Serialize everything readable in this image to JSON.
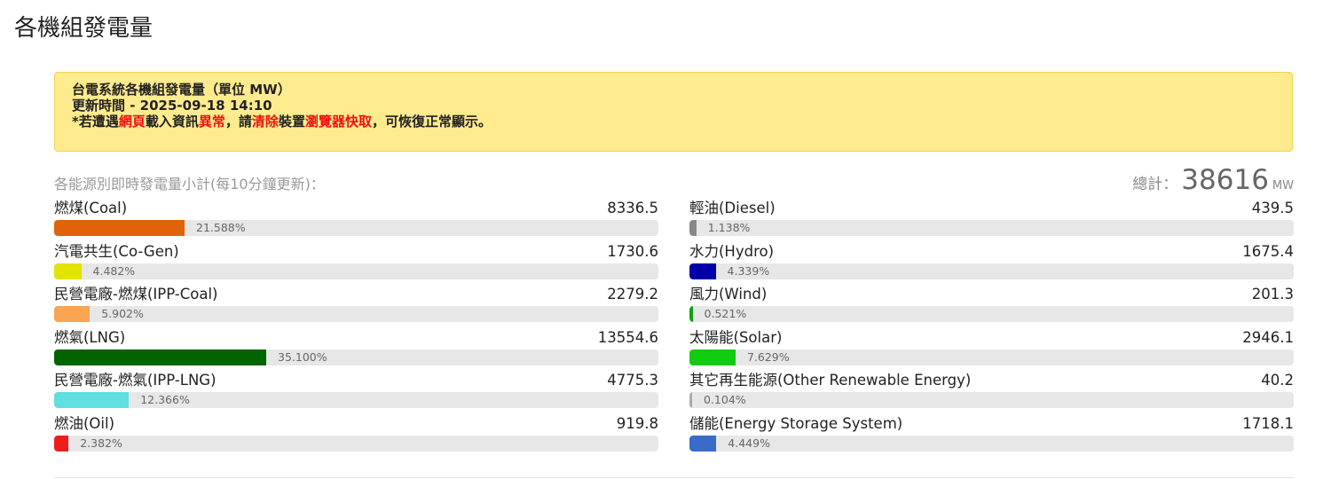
{
  "page_title": "各機組發電量",
  "notice": {
    "line1": "台電系統各機組發電量（單位 MW）",
    "line2": "更新時間 - 2025-09-18 14:10",
    "line3_parts": [
      {
        "text": "*若遭遇",
        "red": false
      },
      {
        "text": "網頁",
        "red": true
      },
      {
        "text": "載入資訊",
        "red": false
      },
      {
        "text": "異常",
        "red": true
      },
      {
        "text": "，請",
        "red": false
      },
      {
        "text": "清除",
        "red": true
      },
      {
        "text": "裝置",
        "red": false
      },
      {
        "text": "瀏覽器快取",
        "red": true
      },
      {
        "text": "，可恢復正常顯示。",
        "red": false
      }
    ]
  },
  "summary": {
    "label": "各能源別即時發電量小計(每10分鐘更新)：",
    "total_label": "總計：",
    "total_value": "38616",
    "total_unit": "MW"
  },
  "colors": {
    "notice_bg": "#fdeb8e",
    "highlight_red": "#ee1111",
    "track_bg": "#e7e7e7"
  },
  "sources_left": [
    {
      "name": "燃煤(Coal)",
      "value": "8336.5",
      "percent_text": "21.588%",
      "percent": 21.588,
      "color": "#e0620a"
    },
    {
      "name": "汽電共生(Co-Gen)",
      "value": "1730.6",
      "percent_text": "4.482%",
      "percent": 4.482,
      "color": "#e3e300"
    },
    {
      "name": "民營電廠-燃煤(IPP-Coal)",
      "value": "2279.2",
      "percent_text": "5.902%",
      "percent": 5.902,
      "color": "#f9a552"
    },
    {
      "name": "燃氣(LNG)",
      "value": "13554.6",
      "percent_text": "35.100%",
      "percent": 35.1,
      "color": "#006400"
    },
    {
      "name": "民營電廠-燃氣(IPP-LNG)",
      "value": "4775.3",
      "percent_text": "12.366%",
      "percent": 12.366,
      "color": "#5fdfdf"
    },
    {
      "name": "燃油(Oil)",
      "value": "919.8",
      "percent_text": "2.382%",
      "percent": 2.382,
      "color": "#ee1c1c"
    }
  ],
  "sources_right": [
    {
      "name": "輕油(Diesel)",
      "value": "439.5",
      "percent_text": "1.138%",
      "percent": 1.138,
      "color": "#888888"
    },
    {
      "name": "水力(Hydro)",
      "value": "1675.4",
      "percent_text": "4.339%",
      "percent": 4.339,
      "color": "#0000a8"
    },
    {
      "name": "風力(Wind)",
      "value": "201.3",
      "percent_text": "0.521%",
      "percent": 0.521,
      "color": "#11a011"
    },
    {
      "name": "太陽能(Solar)",
      "value": "2946.1",
      "percent_text": "7.629%",
      "percent": 7.629,
      "color": "#11cc11"
    },
    {
      "name": "其它再生能源(Other Renewable Energy)",
      "value": "40.2",
      "percent_text": "0.104%",
      "percent": 0.104,
      "color": "#aaaaaa"
    },
    {
      "name": "儲能(Energy Storage System)",
      "value": "1718.1",
      "percent_text": "4.449%",
      "percent": 4.449,
      "color": "#3a6bc8"
    }
  ]
}
